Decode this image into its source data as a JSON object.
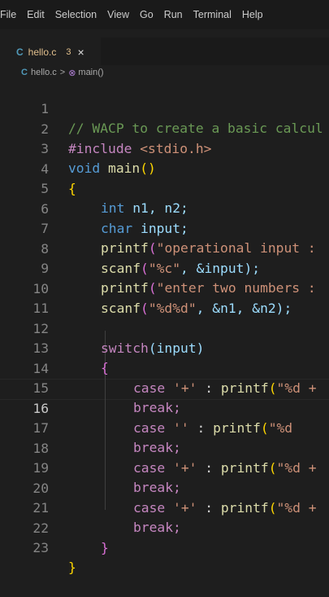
{
  "menu": [
    "File",
    "Edit",
    "Selection",
    "View",
    "Go",
    "Run",
    "Terminal",
    "Help"
  ],
  "tab": {
    "icon": "C",
    "name": "hello.c",
    "badge": "3",
    "close": "×"
  },
  "breadcrumb": {
    "file_icon": "C",
    "file": "hello.c",
    "sep": ">",
    "fn_icon": "⊗",
    "symbol": "main()"
  },
  "line_numbers": [
    "1",
    "2",
    "3",
    "4",
    "5",
    "6",
    "7",
    "8",
    "9",
    "10",
    "11",
    "12",
    "13",
    "14",
    "15",
    "16",
    "17",
    "18",
    "19",
    "20",
    "21",
    "22",
    "23"
  ],
  "code": {
    "l1": "// WACP to create a basic calcul",
    "l2a": "#include",
    "l2b": " <stdio.h>",
    "l3a": "void",
    "l3b": " main",
    "l3c": "()",
    "l4": "{",
    "l5a": "int",
    "l5b": " n1, n2;",
    "l6a": "char",
    "l6b": " input;",
    "l7a": "printf",
    "l7b": "(",
    "l7c": "\"operational input :",
    "l8a": "scanf",
    "l8b": "(",
    "l8c": "\"%c\"",
    "l8d": ", &input);",
    "l9a": "printf",
    "l9b": "(",
    "l9c": "\"enter two numbers :",
    "l10a": "scanf",
    "l10b": "(",
    "l10c": "\"%d%d\"",
    "l10d": ", &n1, &n2);",
    "l12a": "switch",
    "l12b": "(input)",
    "l13": "{",
    "l14a": "case",
    "l14b": " '+'",
    "l14c": " : ",
    "l14d": "printf",
    "l14e": "(",
    "l14f": "\"%d +",
    "l15": "break;",
    "l16a": "case",
    "l16b": " '",
    "l16c": "'",
    "l16d": " : ",
    "l16e": "printf",
    "l16f": "(",
    "l16g": "\"%d ",
    "l17": "break;",
    "l18a": "case",
    "l18b": " '+'",
    "l18c": " : ",
    "l18d": "printf",
    "l18e": "(",
    "l18f": "\"%d +",
    "l19": "break;",
    "l20a": "case",
    "l20b": " '+'",
    "l20c": " : ",
    "l20d": "printf",
    "l20e": "(",
    "l20f": "\"%d +",
    "l21": "break;",
    "l22": "}",
    "l23": "}"
  },
  "active_line": "16"
}
